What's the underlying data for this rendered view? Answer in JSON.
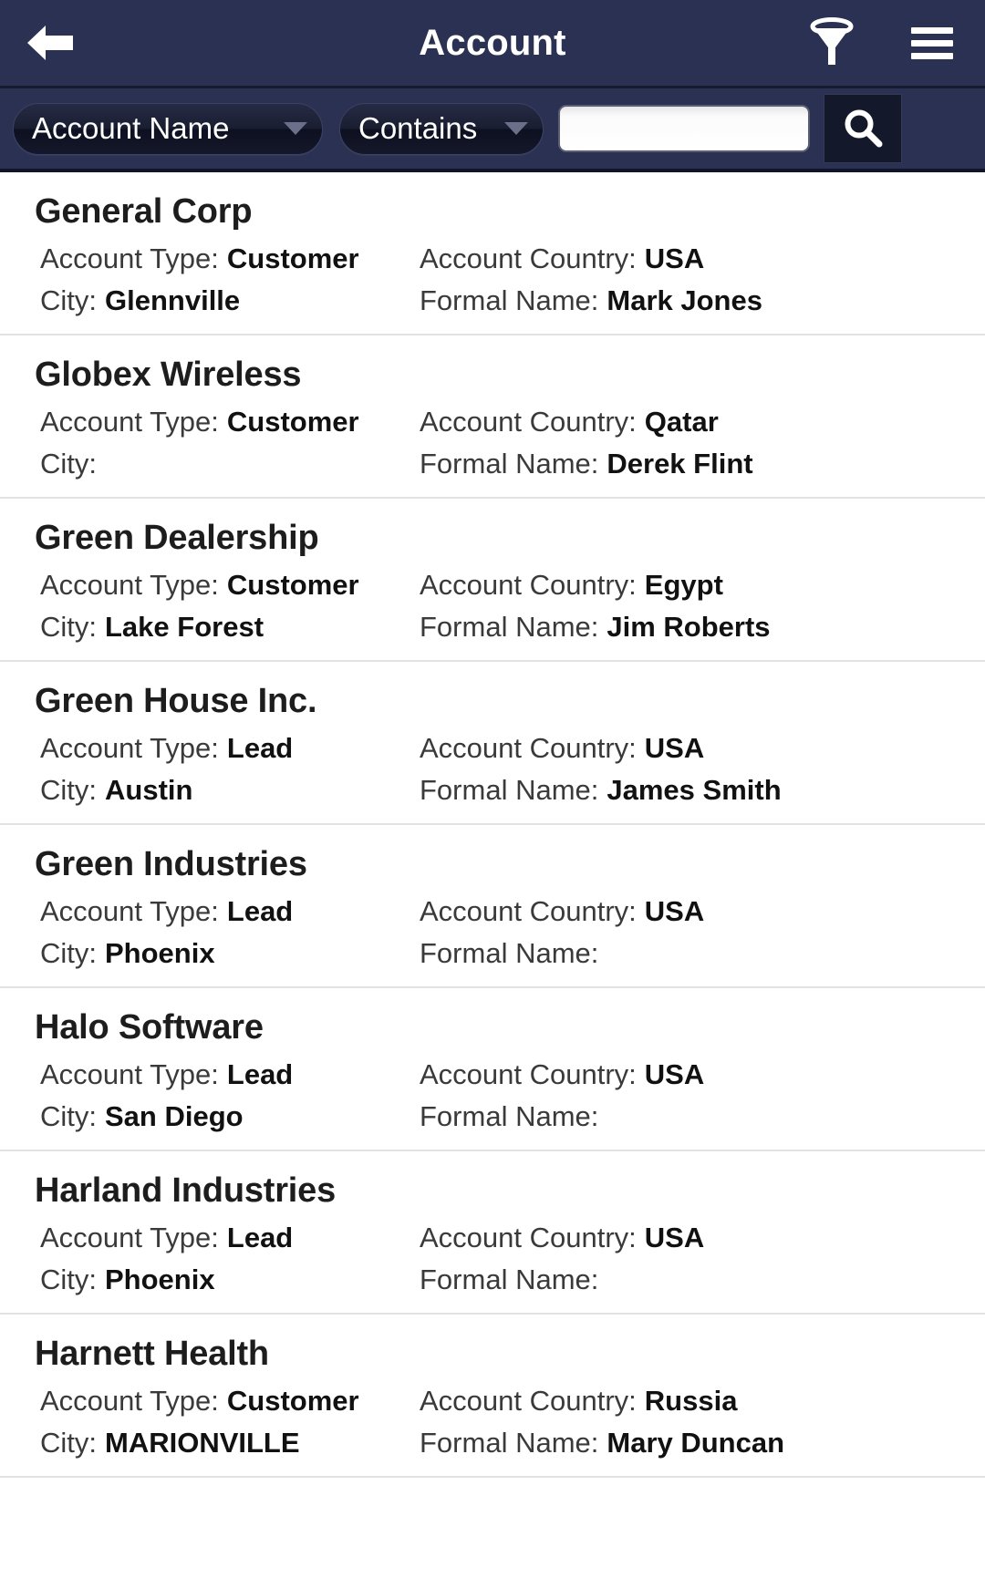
{
  "appbar": {
    "title": "Account",
    "back_icon": "back-arrow-icon",
    "filter_icon": "funnel-filter-icon",
    "menu_icon": "hamburger-menu-icon"
  },
  "searchbar": {
    "field_dropdown": {
      "selected": "Account Name",
      "caret_icon": "chevron-down-icon"
    },
    "operator_dropdown": {
      "selected": "Contains",
      "caret_icon": "chevron-down-icon"
    },
    "search_input": {
      "value": "",
      "placeholder": ""
    },
    "search_button": {
      "icon": "magnifier-search-icon"
    }
  },
  "labels": {
    "account_type": "Account Type:",
    "account_country": "Account Country:",
    "city": "City:",
    "formal_name": "Formal Name:"
  },
  "colors": {
    "appbar_bg": "#2b3152",
    "searchbar_bg": "#2b3152",
    "dropdown_bg": "#14182a",
    "list_bg": "#ffffff",
    "divider": "#e2e2e2",
    "title_text": "#1d1d1d",
    "label_text": "#3a3a3a",
    "value_text": "#111111"
  },
  "accounts": [
    {
      "name": "General Corp",
      "account_type": "Customer",
      "account_country": "USA",
      "city": "Glennville",
      "formal_name": "Mark Jones"
    },
    {
      "name": "Globex Wireless",
      "account_type": "Customer",
      "account_country": "Qatar",
      "city": "",
      "formal_name": "Derek Flint"
    },
    {
      "name": "Green Dealership",
      "account_type": "Customer",
      "account_country": "Egypt",
      "city": "Lake Forest",
      "formal_name": "Jim Roberts"
    },
    {
      "name": "Green House Inc.",
      "account_type": "Lead",
      "account_country": "USA",
      "city": "Austin",
      "formal_name": "James Smith"
    },
    {
      "name": "Green Industries",
      "account_type": "Lead",
      "account_country": "USA",
      "city": "Phoenix",
      "formal_name": ""
    },
    {
      "name": "Halo Software",
      "account_type": "Lead",
      "account_country": "USA",
      "city": "San Diego",
      "formal_name": ""
    },
    {
      "name": "Harland Industries",
      "account_type": "Lead",
      "account_country": "USA",
      "city": "Phoenix",
      "formal_name": ""
    },
    {
      "name": "Harnett Health",
      "account_type": "Customer",
      "account_country": "Russia",
      "city": "MARIONVILLE",
      "formal_name": "Mary Duncan"
    }
  ]
}
